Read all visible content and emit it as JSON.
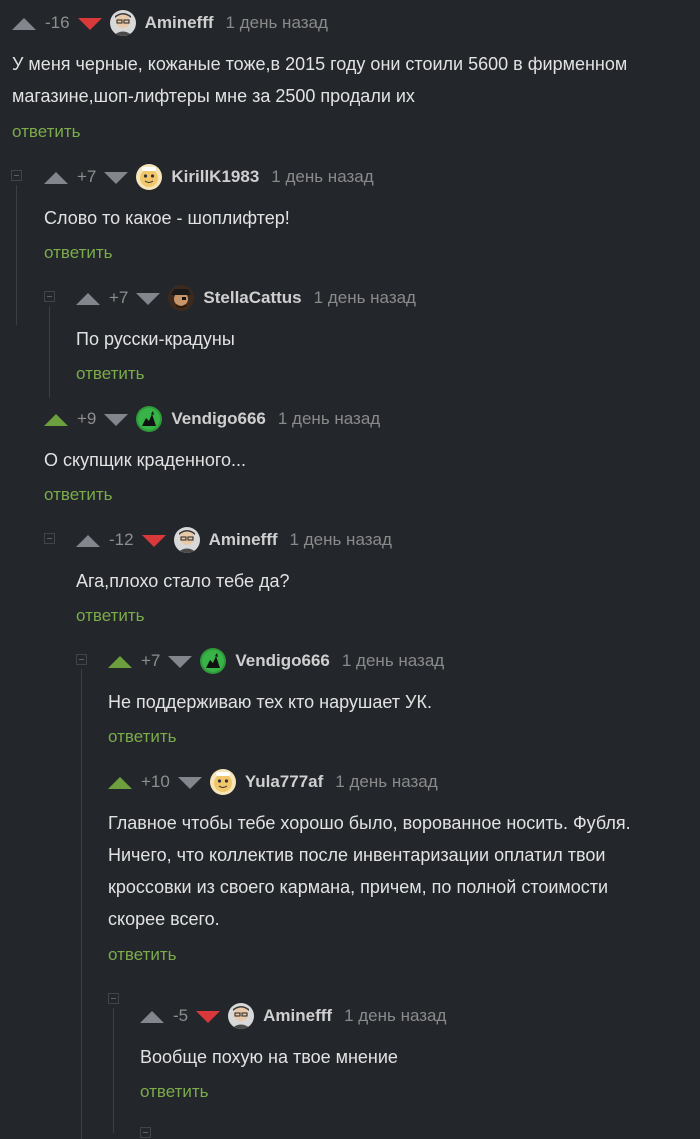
{
  "comments": [
    {
      "rating": "-16",
      "vote": "down",
      "author": "Aminefff",
      "time": "1 день назад",
      "text": "У меня черные, кожаные тоже,в 2015 году они стоили 5600 в фирменном магазине,шоп-лифтеры мне за 2500 продали их",
      "reply": "ответить",
      "avatar": "man-glasses"
    },
    {
      "rating": "+7",
      "vote": "none",
      "author": "KirillK1983",
      "time": "1 день назад",
      "text": "Слово то какое - шоплифтер!",
      "reply": "ответить",
      "avatar": "cartoon-face"
    },
    {
      "rating": "+7",
      "vote": "none",
      "author": "StellaCattus",
      "time": "1 день назад",
      "text": "По русски-крадуны",
      "reply": "ответить",
      "avatar": "pirate"
    },
    {
      "rating": "+9",
      "vote": "up",
      "author": "Vendigo666",
      "time": "1 день назад",
      "text": "О скупщик краденного...",
      "reply": "ответить",
      "avatar": "green-beast"
    },
    {
      "rating": "-12",
      "vote": "down",
      "author": "Aminefff",
      "time": "1 день назад",
      "text": "Ага,плохо стало тебе да?",
      "reply": "ответить",
      "avatar": "man-glasses"
    },
    {
      "rating": "+7",
      "vote": "up",
      "author": "Vendigo666",
      "time": "1 день назад",
      "text": "Не поддерживаю тех кто нарушает УК.",
      "reply": "ответить",
      "avatar": "green-beast"
    },
    {
      "rating": "+10",
      "vote": "up",
      "author": "Yula777af",
      "time": "1 день назад",
      "text": "Главное чтобы тебе хорошо было, ворованное носить. Фубля. Ничего, что коллектив после инвентаризации оплатил твои кроссовки из своего кармана, причем, по полной стоимости скорее всего.",
      "reply": "ответить",
      "avatar": "cartoon-face"
    },
    {
      "rating": "-5",
      "vote": "down",
      "author": "Aminefff",
      "time": "1 день назад",
      "text": "Вообще похую на твое мнение",
      "reply": "ответить",
      "avatar": "man-glasses"
    }
  ],
  "colors": {
    "background": "#23262b",
    "upvote_active": "#6e9f3e",
    "downvote_active": "#d9393b",
    "vote_inactive": "#83878d",
    "reply_link": "#7bab4a"
  }
}
